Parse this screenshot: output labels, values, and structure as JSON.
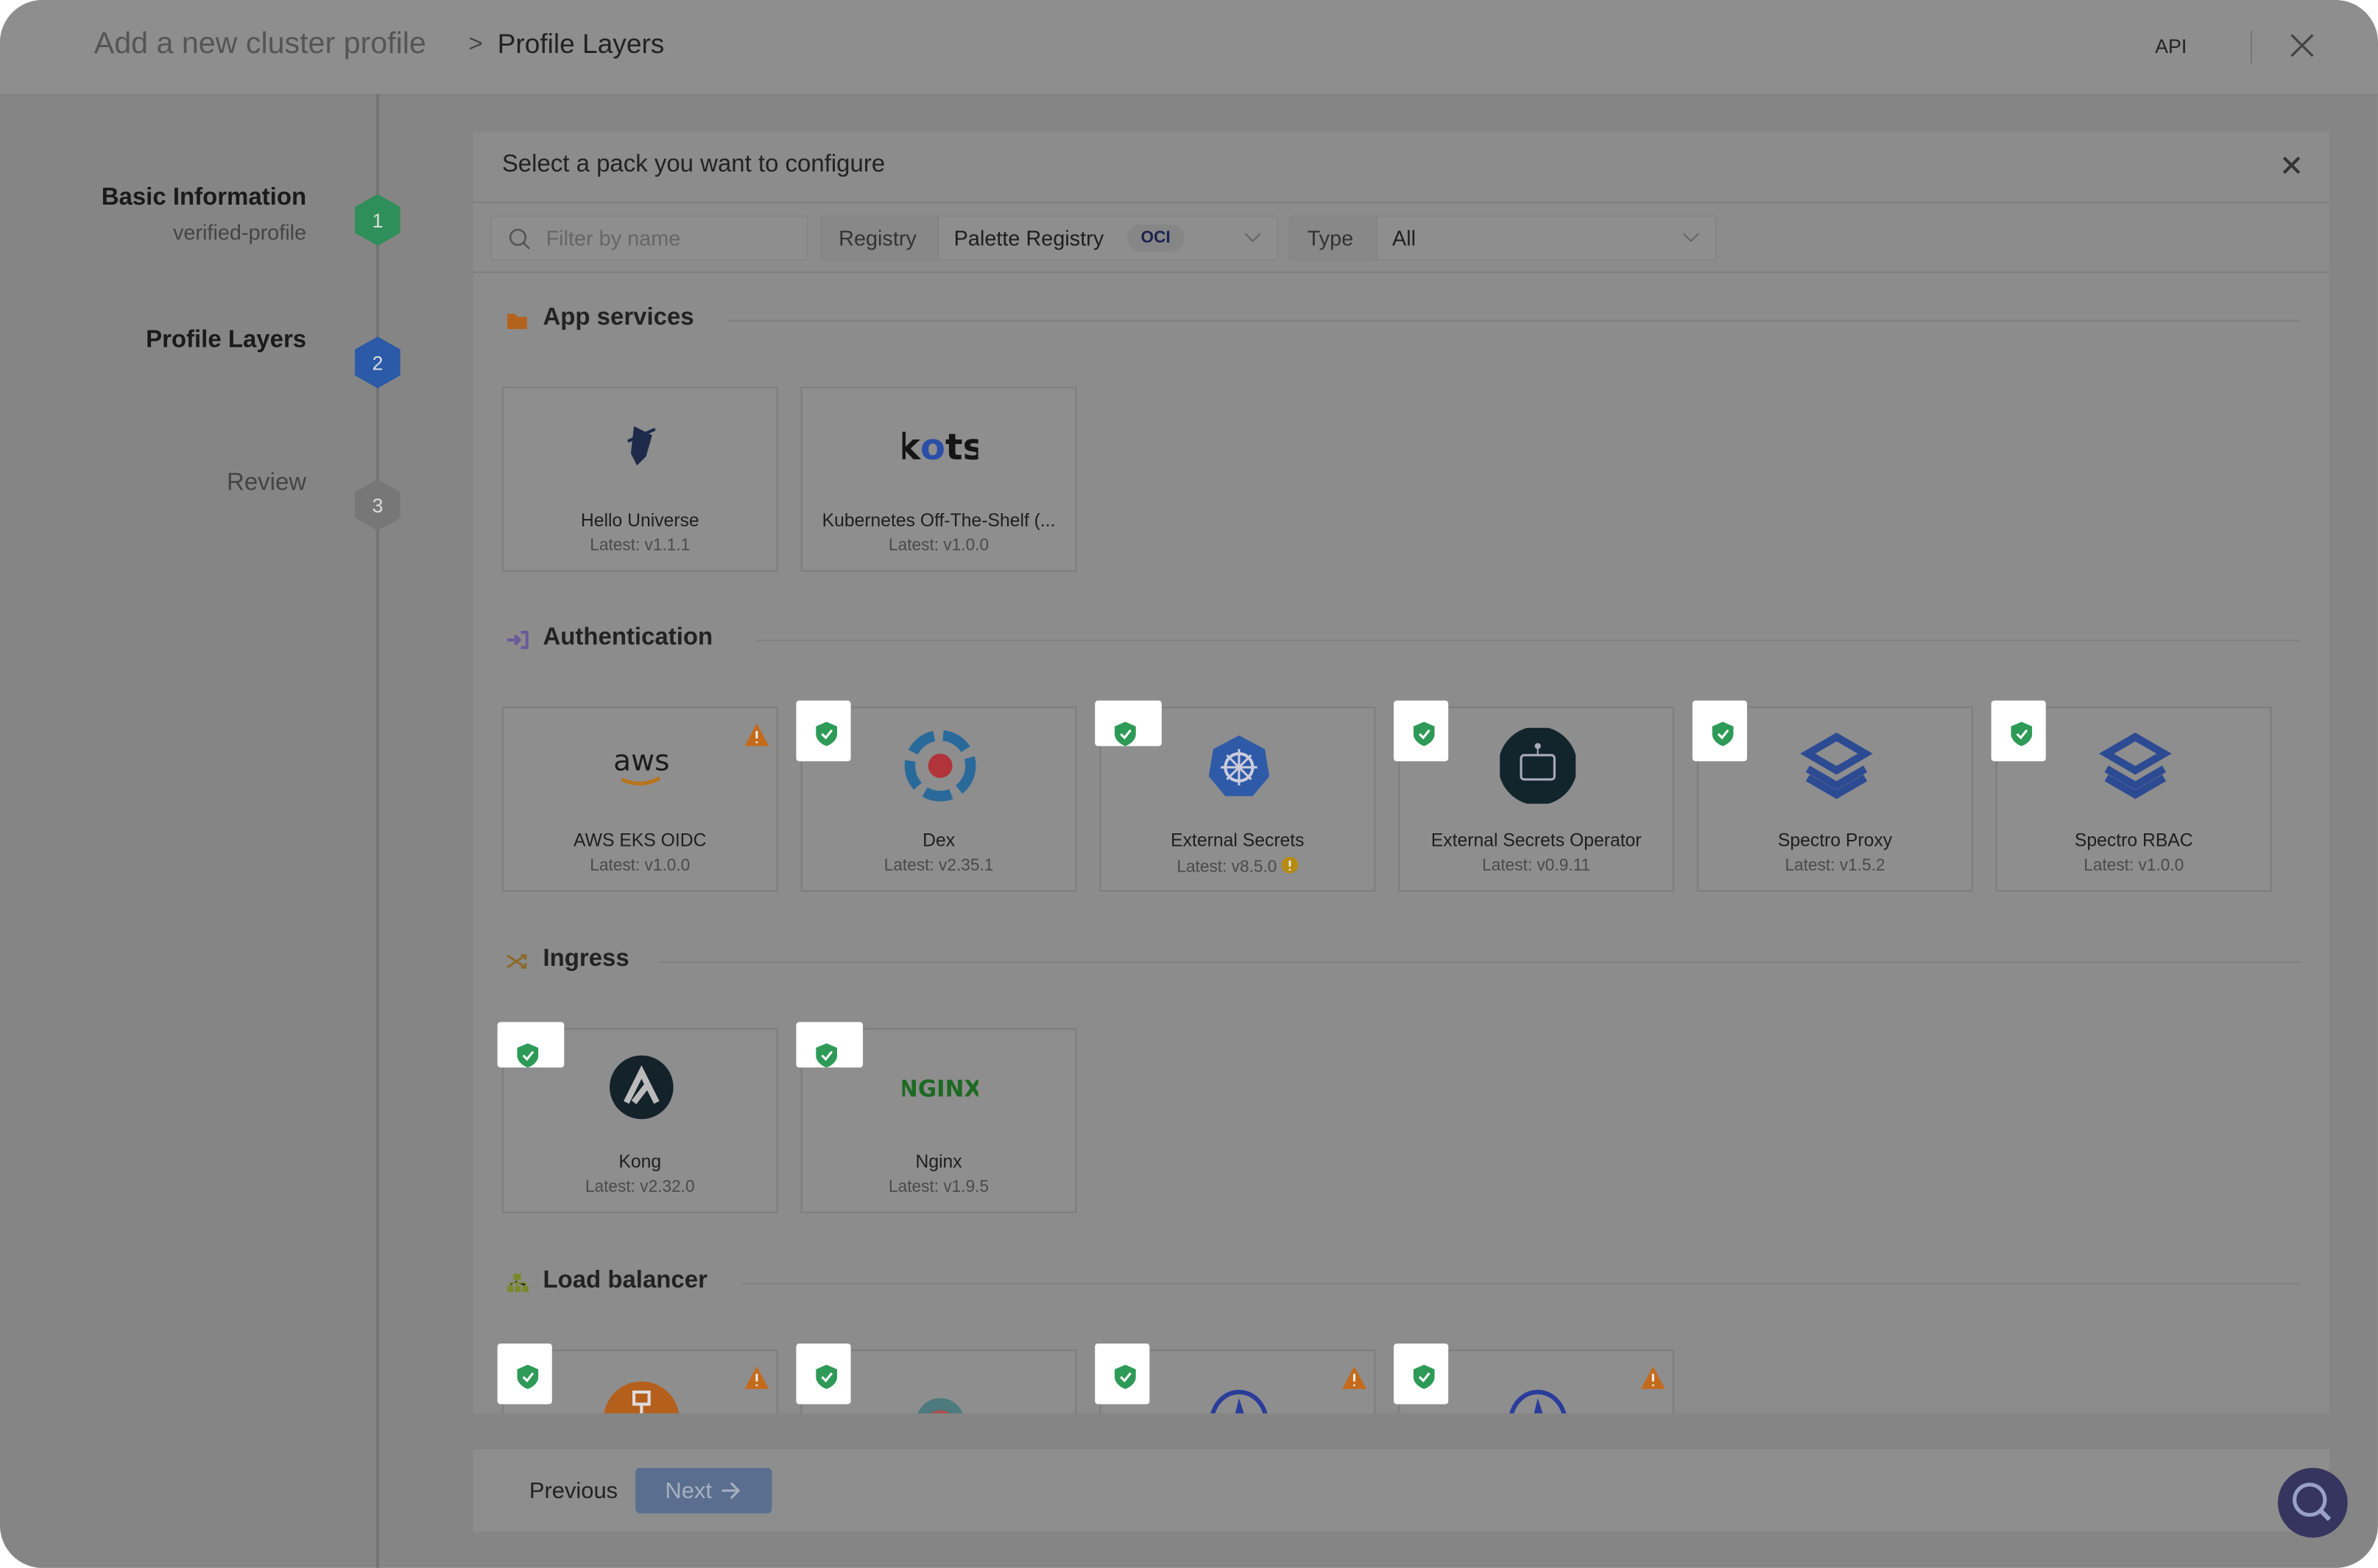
{
  "header": {
    "breadcrumb_parent": "Add a new cluster profile",
    "breadcrumb_separator": ">",
    "breadcrumb_current": "Profile Layers",
    "api_label": "API"
  },
  "steps": [
    {
      "number": "1",
      "title": "Basic Information",
      "subtitle": "verified-profile",
      "state": "complete",
      "color": "#2f8f5a"
    },
    {
      "number": "2",
      "title": "Profile Layers",
      "subtitle": "",
      "state": "active",
      "color": "#2a5aa8"
    },
    {
      "number": "3",
      "title": "Review",
      "subtitle": "",
      "state": "pending",
      "color": "#777777"
    }
  ],
  "panel": {
    "title": "Select a pack you want to configure",
    "filter_placeholder": "Filter by name",
    "registry_label": "Registry",
    "registry_value": "Palette Registry",
    "registry_tag": "OCI",
    "type_label": "Type",
    "type_value": "All",
    "sections": [
      {
        "title": "App services",
        "icon": "folder-icon",
        "cards": [
          {
            "name": "Hello Universe",
            "version": "Latest: v1.1.1",
            "icon": "hello-universe-logo"
          },
          {
            "name": "Kubernetes Off-The-Shelf (...",
            "version": "Latest: v1.0.0",
            "icon": "kots-logo"
          }
        ]
      },
      {
        "title": "Authentication",
        "icon": "sign-in-icon",
        "cards": [
          {
            "name": "AWS EKS OIDC",
            "version": "Latest: v1.0.0",
            "icon": "aws-logo",
            "warning": true
          },
          {
            "name": "Dex",
            "version": "Latest: v2.35.1",
            "icon": "dex-logo",
            "verified": true
          },
          {
            "name": "External Secrets",
            "version": "Latest: v8.5.0",
            "icon": "kubernetes-logo",
            "verified": true,
            "info": true
          },
          {
            "name": "External Secrets Operator",
            "version": "Latest: v0.9.11",
            "icon": "robot-logo",
            "verified": true
          },
          {
            "name": "Spectro Proxy",
            "version": "Latest: v1.5.2",
            "icon": "spectro-logo",
            "verified": true
          },
          {
            "name": "Spectro RBAC",
            "version": "Latest: v1.0.0",
            "icon": "spectro-logo",
            "verified": true
          }
        ]
      },
      {
        "title": "Ingress",
        "icon": "shuffle-icon",
        "cards": [
          {
            "name": "Kong",
            "version": "Latest: v2.32.0",
            "icon": "kong-logo",
            "verified": true
          },
          {
            "name": "Nginx",
            "version": "Latest: v1.9.5",
            "icon": "nginx-logo",
            "verified": true
          }
        ]
      },
      {
        "title": "Load balancer",
        "icon": "network-icon",
        "cards": [
          {
            "name": "",
            "version": "",
            "icon": "load-balancer-logo",
            "verified": true,
            "warning": true
          },
          {
            "name": "",
            "version": "",
            "icon": "external-dns-logo",
            "verified": true
          },
          {
            "name": "",
            "version": "",
            "icon": "metallb-logo",
            "verified": true,
            "warning": true
          },
          {
            "name": "",
            "version": "",
            "icon": "metallb-logo",
            "verified": true,
            "warning": true
          }
        ]
      }
    ]
  },
  "footer": {
    "previous_label": "Previous",
    "next_label": "Next"
  },
  "colors": {
    "verified": "#2e9a57",
    "warning": "#c46a1c",
    "accent": "#5a6f8f"
  }
}
